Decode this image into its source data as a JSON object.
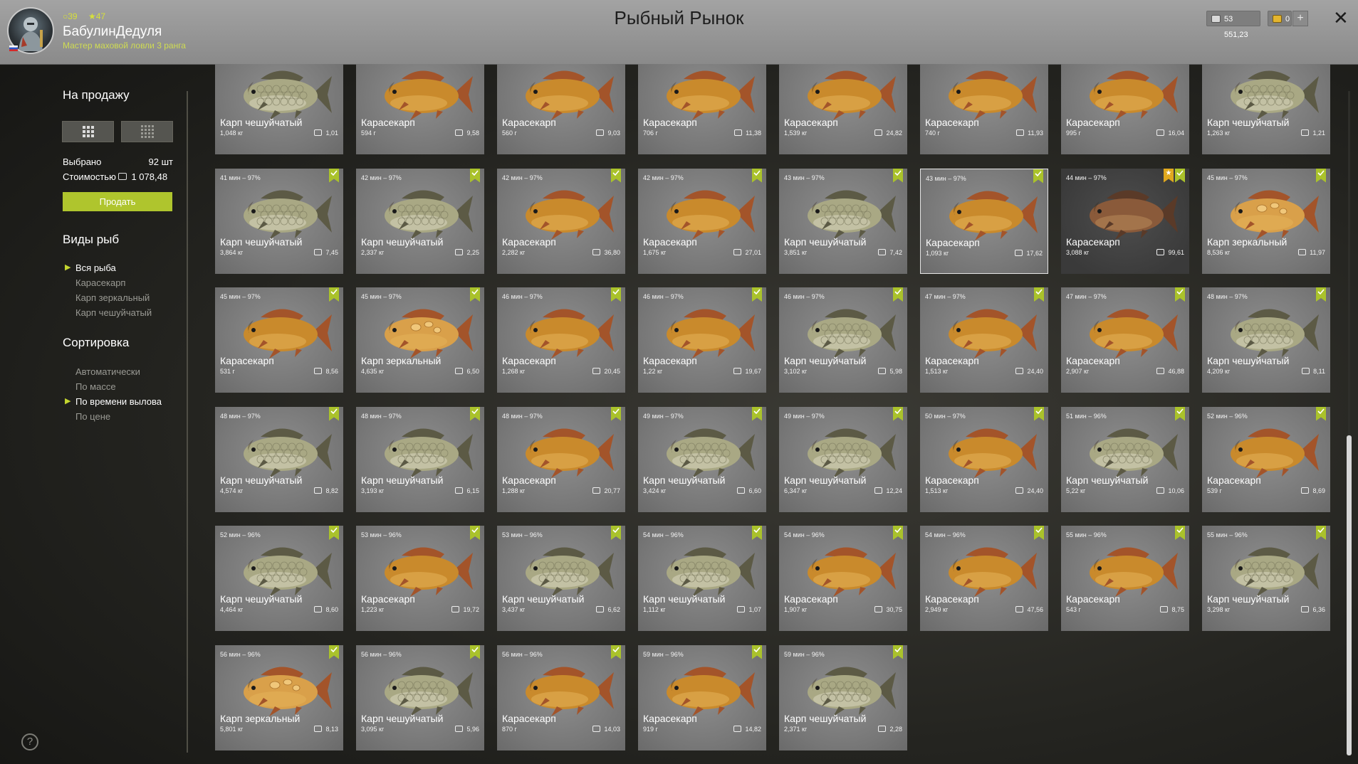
{
  "header": {
    "title": "Рыбный Рынок",
    "player": {
      "name": "БабулинДедуля",
      "rank": "Мастер маховой ловли 3 ранга",
      "level": "39",
      "stars": "47"
    },
    "currency": {
      "silver": "53 551,23",
      "gold": "0"
    },
    "add_label": "+",
    "close_label": "✕"
  },
  "sidebar": {
    "sale_heading": "На продажу",
    "selected_label": "Выбрано",
    "selected_value": "92 шт",
    "cost_label": "Стоимостью",
    "cost_value": "1 078,48",
    "sell_label": "Продать",
    "species_heading": "Виды рыб",
    "species": [
      {
        "label": "Вся рыба",
        "active": true
      },
      {
        "label": "Карасекарп",
        "active": false
      },
      {
        "label": "Карп зеркальный",
        "active": false
      },
      {
        "label": "Карп чешуйчатый",
        "active": false
      }
    ],
    "sort_heading": "Сортировка",
    "sort": [
      {
        "label": "Автоматически",
        "active": false
      },
      {
        "label": "По массе",
        "active": false
      },
      {
        "label": "По времени вылова",
        "active": true
      },
      {
        "label": "По цене",
        "active": false
      }
    ],
    "help_label": "?"
  },
  "fish": [
    {
      "time": "",
      "name": "Карп чешуйчатый",
      "weight": "1,048 кг",
      "price": "1,01",
      "marked": false,
      "type": "scaly"
    },
    {
      "time": "",
      "name": "Карасекарп",
      "weight": "594 г",
      "price": "9,58",
      "marked": false,
      "type": "crucian"
    },
    {
      "time": "",
      "name": "Карасекарп",
      "weight": "560 г",
      "price": "9,03",
      "marked": false,
      "type": "crucian"
    },
    {
      "time": "",
      "name": "Карасекарп",
      "weight": "706 г",
      "price": "11,38",
      "marked": false,
      "type": "crucian"
    },
    {
      "time": "",
      "name": "Карасекарп",
      "weight": "1,539 кг",
      "price": "24,82",
      "marked": false,
      "type": "crucian"
    },
    {
      "time": "",
      "name": "Карасекарп",
      "weight": "740 г",
      "price": "11,93",
      "marked": false,
      "type": "crucian"
    },
    {
      "time": "",
      "name": "Карасекарп",
      "weight": "995 г",
      "price": "16,04",
      "marked": false,
      "type": "crucian"
    },
    {
      "time": "",
      "name": "Карп чешуйчатый",
      "weight": "1,263 кг",
      "price": "1,21",
      "marked": false,
      "type": "scaly"
    },
    {
      "time": "41 мин – 97%",
      "name": "Карп чешуйчатый",
      "weight": "3,864 кг",
      "price": "7,45",
      "marked": true,
      "type": "scaly"
    },
    {
      "time": "42 мин – 97%",
      "name": "Карп чешуйчатый",
      "weight": "2,337 кг",
      "price": "2,25",
      "marked": true,
      "type": "scaly"
    },
    {
      "time": "42 мин – 97%",
      "name": "Карасекарп",
      "weight": "2,282 кг",
      "price": "36,80",
      "marked": true,
      "type": "crucian"
    },
    {
      "time": "42 мин – 97%",
      "name": "Карасекарп",
      "weight": "1,675 кг",
      "price": "27,01",
      "marked": true,
      "type": "crucian"
    },
    {
      "time": "43 мин – 97%",
      "name": "Карп чешуйчатый",
      "weight": "3,851 кг",
      "price": "7,42",
      "marked": true,
      "type": "scaly"
    },
    {
      "time": "43 мин – 97%",
      "name": "Карасекарп",
      "weight": "1,093 кг",
      "price": "17,62",
      "marked": true,
      "type": "crucian",
      "highlighted": true
    },
    {
      "time": "44 мин – 97%",
      "name": "Карасекарп",
      "weight": "3,088 кг",
      "price": "99,61",
      "marked": true,
      "starred": true,
      "type": "dark",
      "dark": true
    },
    {
      "time": "45 мин – 97%",
      "name": "Карп зеркальный",
      "weight": "8,536 кг",
      "price": "11,97",
      "marked": true,
      "type": "mirror"
    },
    {
      "time": "45 мин – 97%",
      "name": "Карасекарп",
      "weight": "531 г",
      "price": "8,56",
      "marked": true,
      "type": "crucian"
    },
    {
      "time": "45 мин – 97%",
      "name": "Карп зеркальный",
      "weight": "4,635 кг",
      "price": "6,50",
      "marked": true,
      "type": "mirror"
    },
    {
      "time": "46 мин – 97%",
      "name": "Карасекарп",
      "weight": "1,268 кг",
      "price": "20,45",
      "marked": true,
      "type": "crucian"
    },
    {
      "time": "46 мин – 97%",
      "name": "Карасекарп",
      "weight": "1,22 кг",
      "price": "19,67",
      "marked": true,
      "type": "crucian"
    },
    {
      "time": "46 мин – 97%",
      "name": "Карп чешуйчатый",
      "weight": "3,102 кг",
      "price": "5,98",
      "marked": true,
      "type": "scaly"
    },
    {
      "time": "47 мин – 97%",
      "name": "Карасекарп",
      "weight": "1,513 кг",
      "price": "24,40",
      "marked": true,
      "type": "crucian"
    },
    {
      "time": "47 мин – 97%",
      "name": "Карасекарп",
      "weight": "2,907 кг",
      "price": "46,88",
      "marked": true,
      "type": "crucian"
    },
    {
      "time": "48 мин – 97%",
      "name": "Карп чешуйчатый",
      "weight": "4,209 кг",
      "price": "8,11",
      "marked": true,
      "type": "scaly"
    },
    {
      "time": "48 мин – 97%",
      "name": "Карп чешуйчатый",
      "weight": "4,574 кг",
      "price": "8,82",
      "marked": true,
      "type": "scaly"
    },
    {
      "time": "48 мин – 97%",
      "name": "Карп чешуйчатый",
      "weight": "3,193 кг",
      "price": "6,15",
      "marked": true,
      "type": "scaly"
    },
    {
      "time": "48 мин – 97%",
      "name": "Карасекарп",
      "weight": "1,288 кг",
      "price": "20,77",
      "marked": true,
      "type": "crucian"
    },
    {
      "time": "49 мин – 97%",
      "name": "Карп чешуйчатый",
      "weight": "3,424 кг",
      "price": "6,60",
      "marked": true,
      "type": "scaly"
    },
    {
      "time": "49 мин – 97%",
      "name": "Карп чешуйчатый",
      "weight": "6,347 кг",
      "price": "12,24",
      "marked": true,
      "type": "scaly"
    },
    {
      "time": "50 мин – 97%",
      "name": "Карасекарп",
      "weight": "1,513 кг",
      "price": "24,40",
      "marked": true,
      "type": "crucian"
    },
    {
      "time": "51 мин – 96%",
      "name": "Карп чешуйчатый",
      "weight": "5,22 кг",
      "price": "10,06",
      "marked": true,
      "type": "scaly"
    },
    {
      "time": "52 мин – 96%",
      "name": "Карасекарп",
      "weight": "539 г",
      "price": "8,69",
      "marked": true,
      "type": "crucian"
    },
    {
      "time": "52 мин – 96%",
      "name": "Карп чешуйчатый",
      "weight": "4,464 кг",
      "price": "8,60",
      "marked": true,
      "type": "scaly"
    },
    {
      "time": "53 мин – 96%",
      "name": "Карасекарп",
      "weight": "1,223 кг",
      "price": "19,72",
      "marked": true,
      "type": "crucian"
    },
    {
      "time": "53 мин – 96%",
      "name": "Карп чешуйчатый",
      "weight": "3,437 кг",
      "price": "6,62",
      "marked": true,
      "type": "scaly"
    },
    {
      "time": "54 мин – 96%",
      "name": "Карп чешуйчатый",
      "weight": "1,112 кг",
      "price": "1,07",
      "marked": true,
      "type": "scaly"
    },
    {
      "time": "54 мин – 96%",
      "name": "Карасекарп",
      "weight": "1,907 кг",
      "price": "30,75",
      "marked": true,
      "type": "crucian"
    },
    {
      "time": "54 мин – 96%",
      "name": "Карасекарп",
      "weight": "2,949 кг",
      "price": "47,56",
      "marked": true,
      "type": "crucian"
    },
    {
      "time": "55 мин – 96%",
      "name": "Карасекарп",
      "weight": "543 г",
      "price": "8,75",
      "marked": true,
      "type": "crucian"
    },
    {
      "time": "55 мин – 96%",
      "name": "Карп чешуйчатый",
      "weight": "3,298 кг",
      "price": "6,36",
      "marked": true,
      "type": "scaly"
    },
    {
      "time": "56 мин – 96%",
      "name": "Карп зеркальный",
      "weight": "5,801 кг",
      "price": "8,13",
      "marked": true,
      "type": "mirror"
    },
    {
      "time": "56 мин – 96%",
      "name": "Карп чешуйчатый",
      "weight": "3,095 кг",
      "price": "5,96",
      "marked": true,
      "type": "scaly"
    },
    {
      "time": "56 мин – 96%",
      "name": "Карасекарп",
      "weight": "870 г",
      "price": "14,03",
      "marked": true,
      "type": "crucian"
    },
    {
      "time": "59 мин – 96%",
      "name": "Карасекарп",
      "weight": "919 г",
      "price": "14,82",
      "marked": true,
      "type": "crucian"
    },
    {
      "time": "59 мин – 96%",
      "name": "Карп чешуйчатый",
      "weight": "2,371 кг",
      "price": "2,28",
      "marked": true,
      "type": "scaly"
    }
  ],
  "colors": {
    "accent": "#afc52d",
    "crucian_body": "#c98a2c",
    "scaly_body": "#a9a884",
    "mirror_body": "#d9a04a",
    "dark_body": "#8a5a3a"
  },
  "scroll_position": 0.51
}
